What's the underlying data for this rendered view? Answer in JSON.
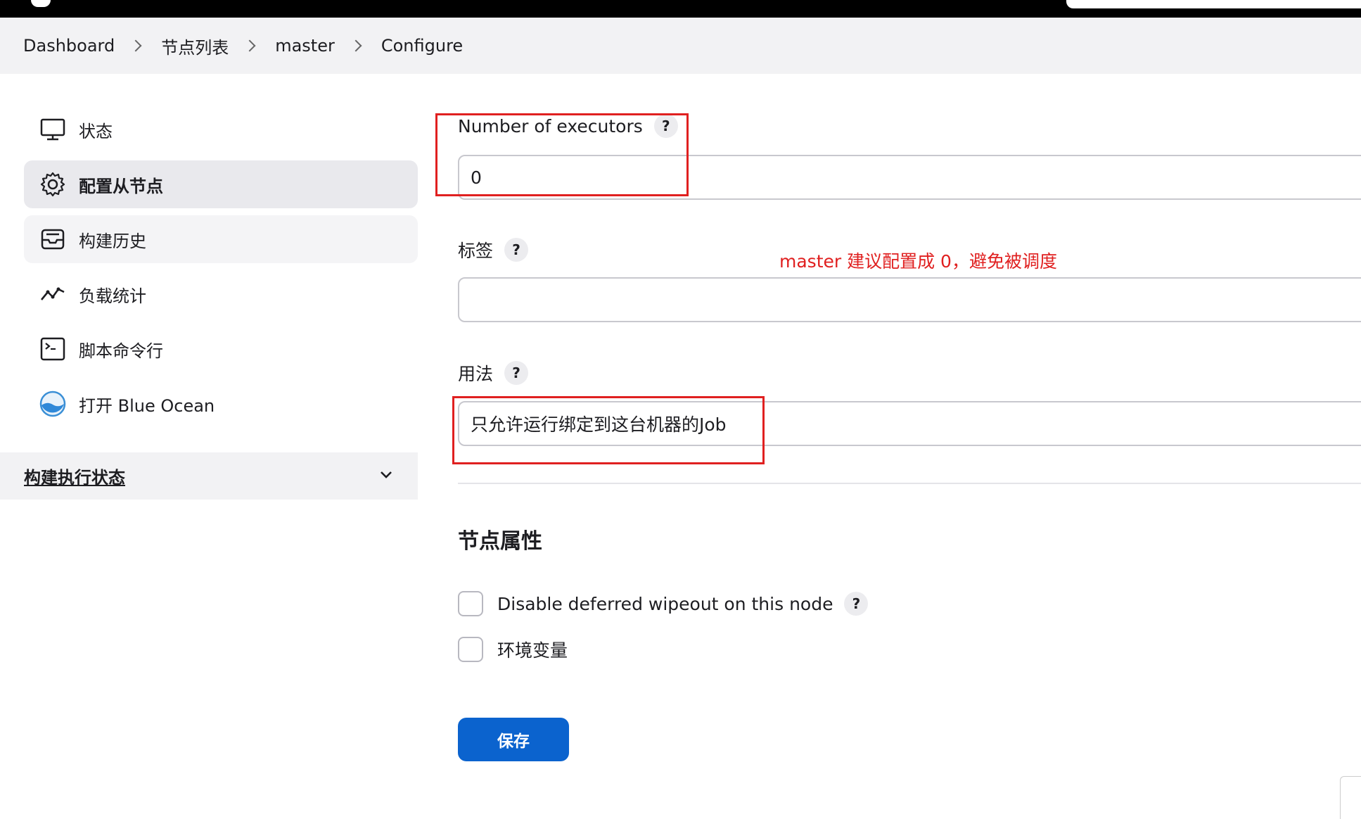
{
  "breadcrumb": [
    "Dashboard",
    "节点列表",
    "master",
    "Configure"
  ],
  "sidebar": {
    "items": [
      {
        "label": "状态",
        "icon": "monitor-icon"
      },
      {
        "label": "配置从节点",
        "icon": "gear-icon"
      },
      {
        "label": "构建历史",
        "icon": "inbox-icon"
      },
      {
        "label": "负载统计",
        "icon": "trend-line-icon"
      },
      {
        "label": "脚本命令行",
        "icon": "terminal-icon"
      },
      {
        "label": "打开 Blue Ocean",
        "icon": "blue-ocean-icon"
      }
    ],
    "executor_status_label": "构建执行状态"
  },
  "form": {
    "executors_label": "Number of executors",
    "executors_value": "0",
    "labels_label": "标签",
    "labels_value": "",
    "usage_label": "用法",
    "usage_value": "只允许运行绑定到这台机器的Job",
    "help_symbol": "?",
    "node_properties_title": "节点属性",
    "checkbox_wipeout_label": "Disable deferred wipeout on this node",
    "checkbox_env_label": "环境变量",
    "save_label": "保存"
  },
  "annotation": "master 建议配置成 0，避免被调度",
  "colors": {
    "annotation_red": "#e02020",
    "primary_blue": "#0b63ce"
  }
}
